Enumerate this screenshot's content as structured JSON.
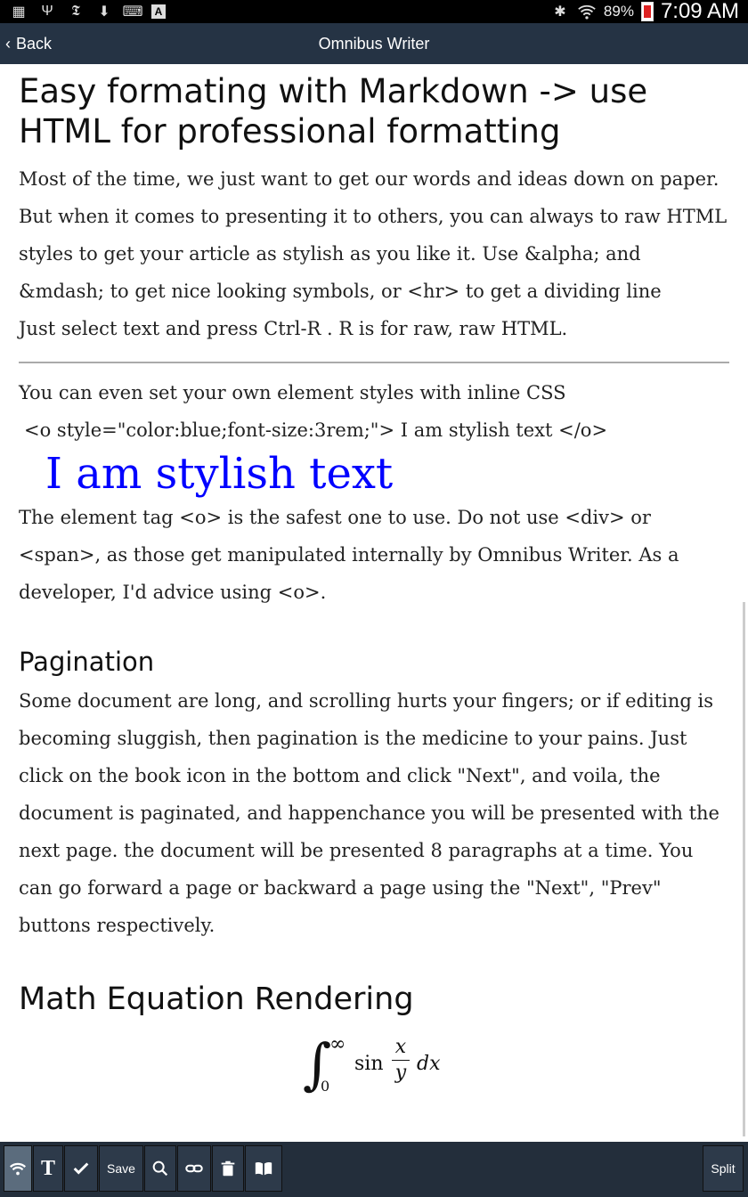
{
  "status_bar": {
    "battery": "89%",
    "time": "7:09 AM",
    "left_icons": [
      "sd-card-icon",
      "usb-icon",
      "news-icon",
      "download-icon",
      "keyboard-icon",
      "a-icon"
    ],
    "right_icons": [
      "bluetooth-icon",
      "wifi-icon"
    ]
  },
  "action_bar": {
    "back_label": "Back",
    "title": "Omnibus Writer"
  },
  "content": {
    "heading1": "Easy formating with Markdown -> use HTML for professional formatting",
    "para1": "Most of the time, we just want to get our words and ideas down on paper. But when it comes to presenting it to others, you can always to raw HTML styles to get your article as stylish as you like it. Use &alpha; and &mdash; to get nice looking symbols, or <hr> to get a dividing line",
    "para2": "Just select text and press Ctrl-R . R is for raw, raw HTML.",
    "para3": "You can even set your own element styles with inline CSS",
    "para4": "<o style=\"color:blue;font-size:3rem;\"> I am stylish text </o>",
    "stylish": "I am stylish text",
    "para5": "The element tag <o> is the safest one to use. Do not use <div> or <span>, as those get manipulated internally by Omnibus Writer. As a developer, I'd advice using <o>.",
    "heading_pagination": "Pagination",
    "para6": "Some document are long, and scrolling hurts your fingers; or if editing is becoming sluggish, then pagination is the medicine to your pains. Just click on the book icon in the bottom and click \"Next\", and voila, the document is paginated, and happenchance you will be presented with the next page. the document will be presented 8 paragraphs at a time. You can go forward a page or backward a page using the \"Next\", \"Prev\" buttons respectively.",
    "heading_math": "Math Equation Rendering"
  },
  "math": {
    "integral": "∫",
    "upper": "∞",
    "lower": "0",
    "func": "sin",
    "num": "x",
    "den": "y",
    "dx": "dx"
  },
  "toolbar": {
    "save_label": "Save",
    "split_label": "Split"
  }
}
